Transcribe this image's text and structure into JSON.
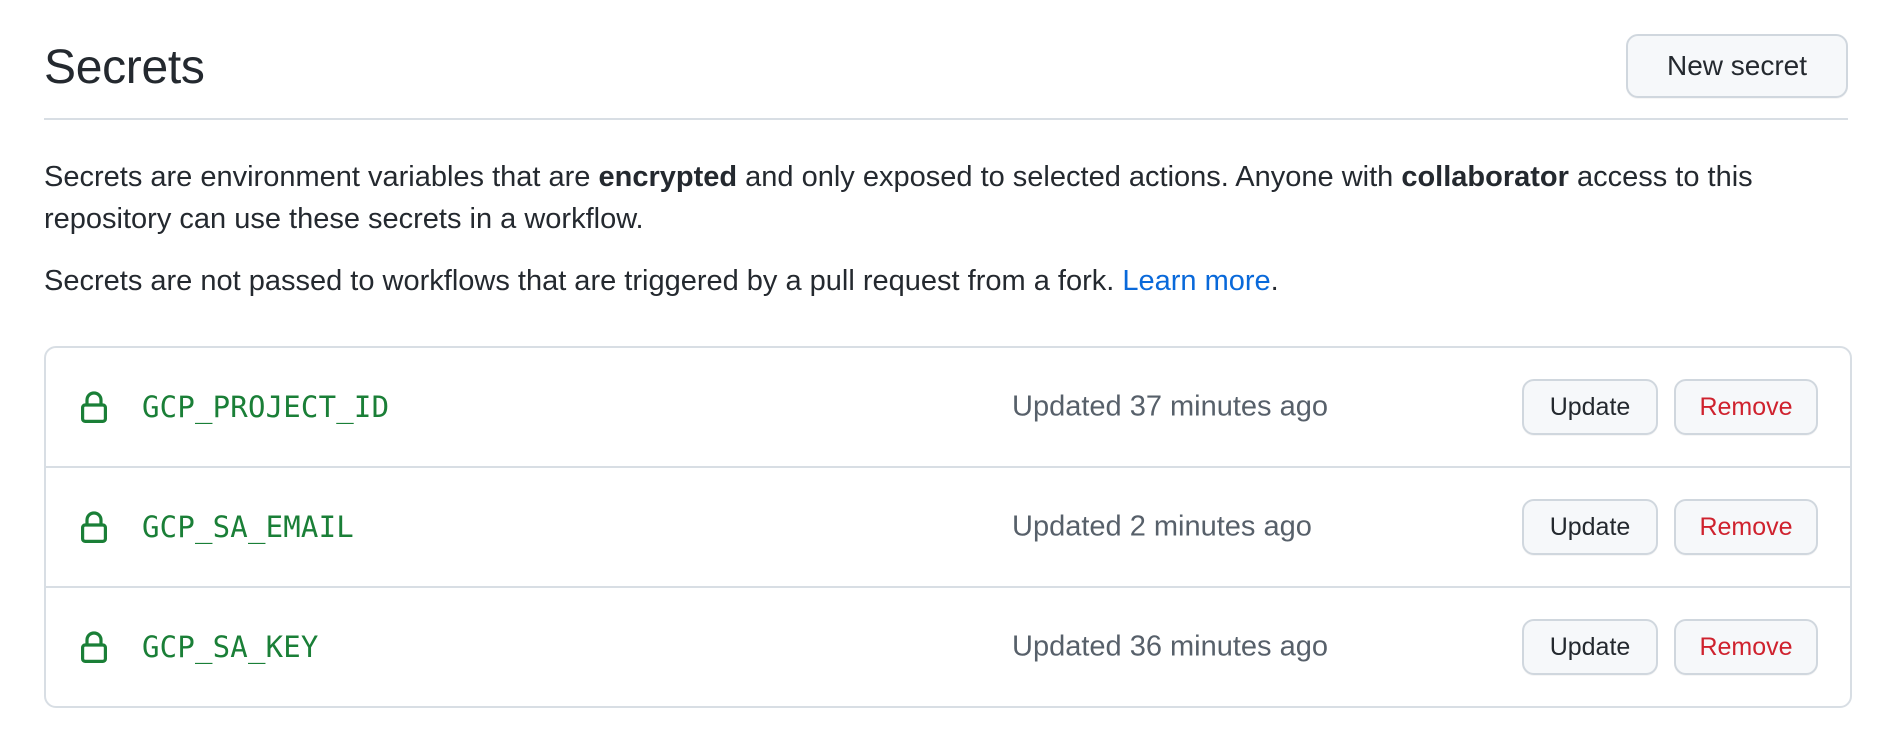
{
  "header": {
    "title": "Secrets",
    "new_secret_label": "New secret"
  },
  "description": {
    "p1_part1": "Secrets are environment variables that are ",
    "p1_bold1": "encrypted",
    "p1_part2": " and only exposed to selected actions. Anyone with ",
    "p1_bold2": "collaborator",
    "p1_part3": " access to this repository can use these secrets in a workflow.",
    "p2_text": "Secrets are not passed to workflows that are triggered by a pull request from a fork. ",
    "p2_link": "Learn more",
    "p2_end": "."
  },
  "secrets": [
    {
      "name": "GCP_PROJECT_ID",
      "updated": "Updated 37 minutes ago",
      "update_label": "Update",
      "remove_label": "Remove",
      "icon": "lock-icon"
    },
    {
      "name": "GCP_SA_EMAIL",
      "updated": "Updated 2 minutes ago",
      "update_label": "Update",
      "remove_label": "Remove",
      "icon": "lock-icon"
    },
    {
      "name": "GCP_SA_KEY",
      "updated": "Updated 36 minutes ago",
      "update_label": "Update",
      "remove_label": "Remove",
      "icon": "lock-icon"
    }
  ],
  "colors": {
    "secret_name": "#1a7f37",
    "link": "#0969da",
    "remove": "#cf222e",
    "muted": "#57606a",
    "border": "#d8dee4"
  }
}
